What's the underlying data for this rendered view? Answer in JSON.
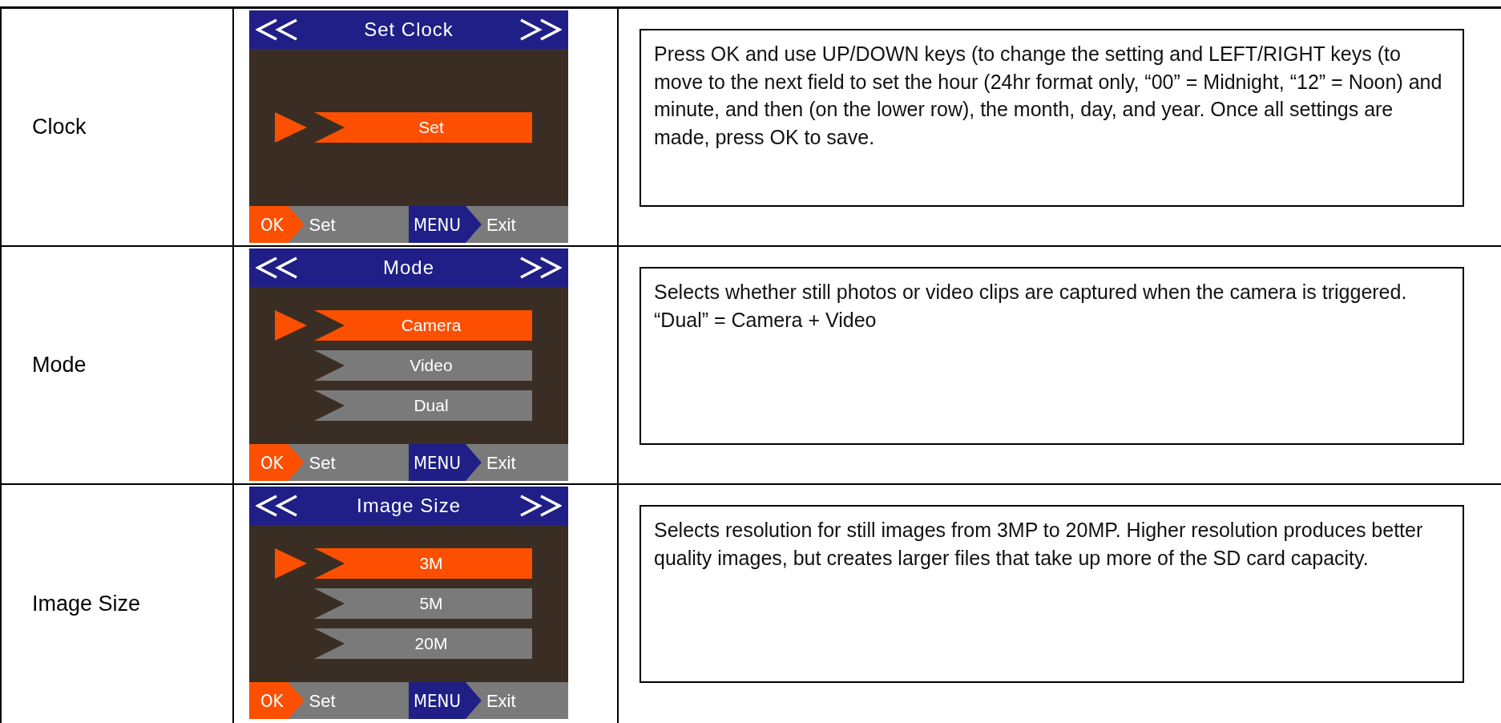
{
  "rows": [
    {
      "label": "Clock",
      "screen": {
        "title": "Set Clock",
        "items": [
          {
            "label": "Set",
            "selected": true
          }
        ],
        "footer": [
          {
            "key": "OK",
            "action": "Set",
            "kind": "ok"
          },
          {
            "key": "MENU",
            "action": "Exit",
            "kind": "menu"
          }
        ]
      },
      "description": "Press OK and use UP/DOWN keys (to change the setting and LEFT/RIGHT keys (to move to the next field to set the hour (24hr format only, “00” = Midnight, “12” = Noon) and minute, and then (on the lower row), the month, day, and year.  Once all settings are made, press OK to save."
    },
    {
      "label": "Mode",
      "screen": {
        "title": "Mode",
        "items": [
          {
            "label": "Camera",
            "selected": true
          },
          {
            "label": "Video",
            "selected": false
          },
          {
            "label": "Dual",
            "selected": false
          }
        ],
        "footer": [
          {
            "key": "OK",
            "action": "Set",
            "kind": "ok"
          },
          {
            "key": "MENU",
            "action": "Exit",
            "kind": "menu"
          }
        ]
      },
      "description": "Selects whether still photos or video clips are captured when the camera is triggered.  “Dual” = Camera + Video"
    },
    {
      "label": "Image Size",
      "screen": {
        "title": "Image Size",
        "items": [
          {
            "label": "3M",
            "selected": true
          },
          {
            "label": "5M",
            "selected": false
          },
          {
            "label": "20M",
            "selected": false
          }
        ],
        "footer": [
          {
            "key": "OK",
            "action": "Set",
            "kind": "ok"
          },
          {
            "key": "MENU",
            "action": "Exit",
            "kind": "menu"
          }
        ]
      },
      "description": "Selects resolution for still images from 3MP to 20MP.  Higher resolution produces better quality images, but creates larger files that take up more of the SD card capacity."
    }
  ]
}
